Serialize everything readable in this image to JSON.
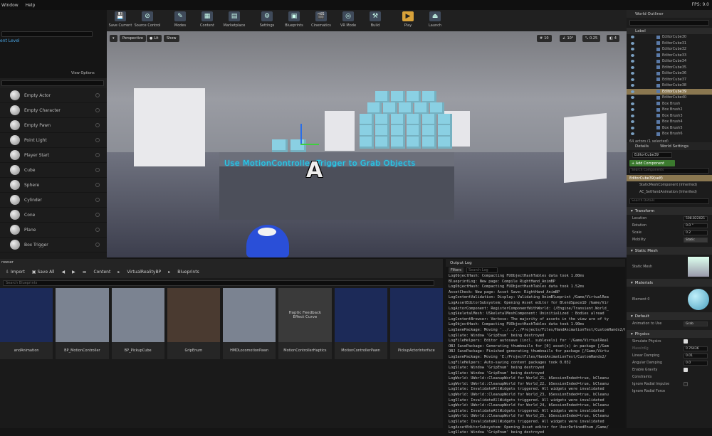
{
  "menu": {
    "window": "Window",
    "help": "Help",
    "fps": "FPS: 9.0"
  },
  "toolbar": [
    {
      "label": "Save Current",
      "icon": "save-icon",
      "glyph": "💾"
    },
    {
      "label": "Source Control",
      "icon": "source-control-icon",
      "glyph": "⊘"
    },
    {
      "label": "Modes",
      "icon": "modes-icon",
      "glyph": "✎"
    },
    {
      "label": "Content",
      "icon": "content-icon",
      "glyph": "▦"
    },
    {
      "label": "Marketplace",
      "icon": "marketplace-icon",
      "glyph": "▤"
    },
    {
      "label": "Settings",
      "icon": "settings-icon",
      "glyph": "⚙"
    },
    {
      "label": "Blueprints",
      "icon": "blueprints-icon",
      "glyph": "▣"
    },
    {
      "label": "Cinematics",
      "icon": "cinematics-icon",
      "glyph": "🎬"
    },
    {
      "label": "VR Mode",
      "icon": "vr-mode-icon",
      "glyph": "◎"
    },
    {
      "label": "Build",
      "icon": "build-icon",
      "glyph": "⚒"
    },
    {
      "label": "Play",
      "icon": "play-icon",
      "glyph": "▶"
    },
    {
      "label": "Launch",
      "icon": "launch-icon",
      "glyph": "⏏"
    }
  ],
  "left": {
    "current_level": "ent Level",
    "view_options": "View Options",
    "place_items": [
      "Empty Actor",
      "Empty Character",
      "Empty Pawn",
      "Point Light",
      "Player Start",
      "Cube",
      "Sphere",
      "Cylinder",
      "Cone",
      "Plane",
      "Box Trigger"
    ]
  },
  "viewport": {
    "perspective": "Perspective",
    "lit": "Lit",
    "show": "Show",
    "text": "Use MotionController Trigger to Grab Objects",
    "letter": "A",
    "grid": "10",
    "rot": "10°",
    "scale": "0.25",
    "cam": "4"
  },
  "outliner": {
    "title": "World Outliner",
    "label": "Label",
    "items": [
      "EditorCube30",
      "EditorCube31",
      "EditorCube32",
      "EditorCube33",
      "EditorCube34",
      "EditorCube35",
      "EditorCube36",
      "EditorCube37",
      "EditorCube38",
      "EditorCube39",
      "EditorCube40",
      "Box Brush",
      "Box Brush2",
      "Box Brush3",
      "Box Brush4",
      "Box Brush5",
      "Box Brush6"
    ],
    "selected": "EditorCube39",
    "count": "64 actors (1 selected)"
  },
  "details": {
    "tab1": "Details",
    "tab2": "World Settings",
    "name": "EditorCube39",
    "add": "+ Add Component",
    "search": "Search Components",
    "self": "EditorCube39(self)",
    "comps": [
      "StaticMeshComponent (Inherited)",
      "AC_SetHandAnimation (Inherited)"
    ],
    "search_details": "Search Details",
    "transform": "Transform",
    "location": "Location",
    "loc_v": "508.822021",
    "rotation": "Rotation",
    "rot_v": "0.0 °",
    "scale": "Scale",
    "scale_v": "0.2",
    "mobility": "Mobility",
    "static": "Static",
    "static_mesh": "Static Mesh",
    "static_mesh_prop": "Static Mesh",
    "materials": "Materials",
    "element": "Element 0",
    "default": "Default",
    "anim": "Animation to Use",
    "grab": "Grab",
    "physics": "Physics",
    "sim": "Simulate Physics",
    "mass": "MassInKg",
    "mass_v": "0.76436",
    "ldamp": "Linear Damping",
    "ldamp_v": "0.01",
    "adamp": "Angular Damping",
    "adamp_v": "0.0",
    "grav": "Enable Gravity",
    "constraints": "Constraints",
    "ig": "Ignore Radial Impulse",
    "igf": "Ignore Radial Force"
  },
  "content": {
    "title": "rowser",
    "import": "Import",
    "save_all": "Save All",
    "path": [
      "Content",
      "VirtualRealityBP",
      "Blueprints"
    ],
    "search": "Search Blueprints",
    "assets": [
      "andAnimation",
      "BP_MotionController",
      "BP_PickupCube",
      "GripEnum",
      "HMDLocomotionPawn",
      "MotionControllerHaptics",
      "MotionControllerPawn",
      "PickupActorInterface"
    ],
    "haptic_thumb": "Haptic Feedback Effect Curve"
  },
  "log": {
    "title": "Output Log",
    "filters": "Filters",
    "search": "Search Log",
    "lines": [
      "LogObjectHash: Compacting FUObjectHashTables data took   1.80ms",
      "BlueprintLog: New page: Compile RightHand_AnimBP",
      "LogObjectHash: Compacting FUObjectHashTables data took   1.52ms",
      "AssetCheck: New page: Asset Save: RightHand_AnimBP",
      "LogContentValidation: Display: Validating AnimBlueprint /Game/VirtualRea",
      "LogAssetEditorSubsystem: Opening Asset editor for BlendSpace1D /Game/Vir",
      "LogActorComponent: RegisterComponentWithWorld: (/Engine/Transient.World_",
      "LogSkeletalMesh: USkeletalMeshComponent: Uninitialized : Bodies alread",
      "LogContentBrowser: Verbose: The majority of assets in the view are of ty",
      "LogObjectHash: Compacting FUObjectHashTables data took   1.90ms",
      "LogSavePackage: Moving '../../../Projects/Files/HandAnimationTest/CustomHands2/G",
      "LogSlate: Window 'GripEnum' being destroyed",
      "LogFileHelpers: Editor autosave (incl. sublevels) for '/Game/VirtualReal",
      "OBJ SavePackage: Generating thumbnails for [0] asset(s) in package [/Gam",
      "OBJ SavePackage: Finished generating thumbnails for package [/Game/Virtu",
      "LogSavePackage: Moving 'E:/ProjectFiles/HandAnimationTest/CustomHands2/",
      "LogFileHelpers: Auto-saving content packages took 0.032",
      "LogSlate: Window 'GripEnum' being destroyed",
      "LogSlate: Window 'GripEnum' being destroyed",
      "LogWorld: UWorld::CleanupWorld for World_21, bSessionEnded=true, bCleanu",
      "LogWorld: UWorld::CleanupWorld for World_22, bSessionEnded=true, bCleanu",
      "LogSlate: InvalidateAllWidgets triggered.  All widgets were invalidated",
      "LogWorld: UWorld::CleanupWorld for World_23, bSessionEnded=true, bCleanu",
      "LogSlate: InvalidateAllWidgets triggered.  All widgets were invalidated",
      "LogWorld: UWorld::CleanupWorld for World_24, bSessionEnded=true, bCleanu",
      "LogSlate: InvalidateAllWidgets triggered.  All widgets were invalidated",
      "LogWorld: UWorld::CleanupWorld for World_25, bSessionEnded=true, bCleanu",
      "LogSlate: InvalidateAllWidgets triggered.  All widgets were invalidated",
      "LogAssetEditorSubsystem: Opening Asset editor for UserDefinedEnum /Game/",
      "LogSlate: Window 'GripEnum' being destroyed"
    ]
  }
}
